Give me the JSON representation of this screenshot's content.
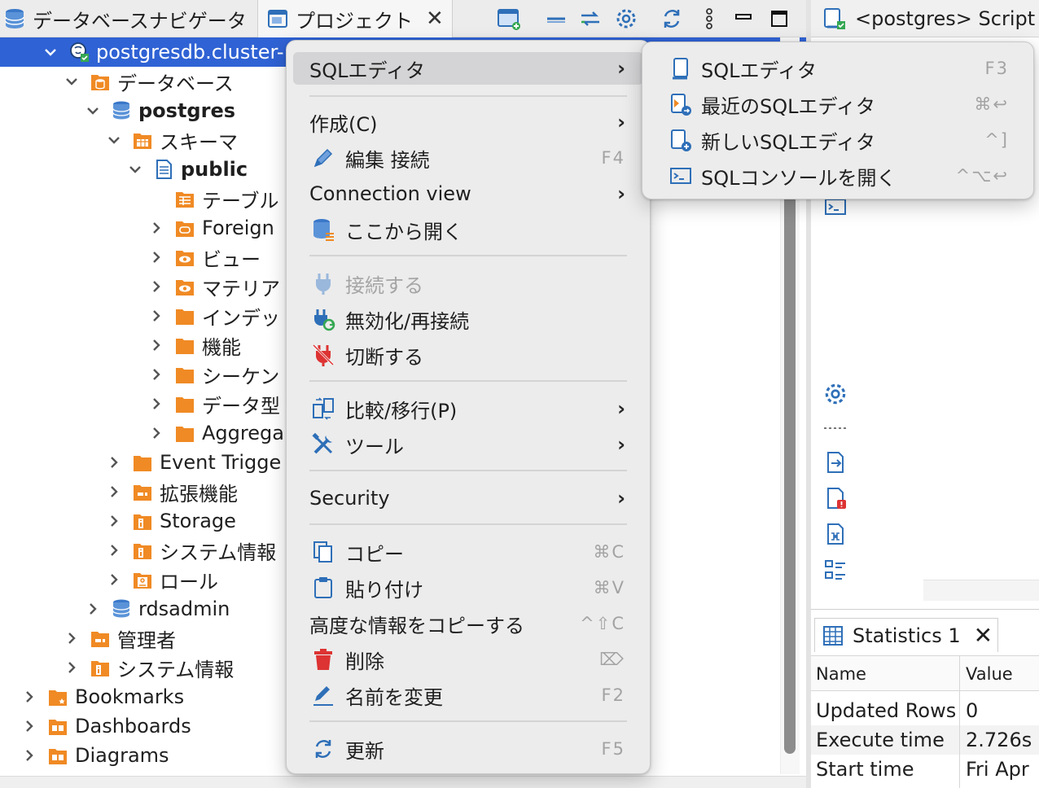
{
  "tabs": {
    "database_navigator": "データベースナビゲータ",
    "projects": "プロジェクト",
    "script": "<postgres> Script"
  },
  "tree": [
    {
      "label": "postgresdb.cluster-",
      "bold": false,
      "expanded": true,
      "icon": "postgres-connection-icon"
    },
    {
      "label": "データベース",
      "expanded": true,
      "icon": "database-folder-icon"
    },
    {
      "label": "postgres",
      "bold": true,
      "expanded": true,
      "icon": "database-icon"
    },
    {
      "label": "スキーマ",
      "expanded": true,
      "icon": "schema-folder-icon"
    },
    {
      "label": "public",
      "bold": true,
      "expanded": true,
      "icon": "schema-icon"
    },
    {
      "label": "テーブル",
      "icon": "table-folder-icon"
    },
    {
      "label": "Foreign",
      "icon": "foreign-table-folder-icon"
    },
    {
      "label": "ビュー",
      "icon": "view-folder-icon"
    },
    {
      "label": "マテリア",
      "icon": "materialized-view-folder-icon"
    },
    {
      "label": "インデッ",
      "icon": "folder-icon"
    },
    {
      "label": "機能",
      "icon": "folder-icon"
    },
    {
      "label": "シーケン",
      "icon": "folder-icon"
    },
    {
      "label": "データ型",
      "icon": "folder-icon"
    },
    {
      "label": "Aggrega",
      "icon": "folder-icon"
    },
    {
      "label": "Event Trigge",
      "icon": "folder-icon"
    },
    {
      "label": "拡張機能",
      "icon": "extension-folder-icon"
    },
    {
      "label": "Storage",
      "icon": "info-folder-icon"
    },
    {
      "label": "システム情報",
      "icon": "info-folder-icon"
    },
    {
      "label": "ロール",
      "icon": "role-folder-icon"
    },
    {
      "label": "rdsadmin",
      "icon": "database-icon"
    },
    {
      "label": "管理者",
      "icon": "extension-folder-icon"
    },
    {
      "label": "システム情報",
      "icon": "info-folder-icon"
    },
    {
      "label": "Bookmarks",
      "icon": "bookmarks-folder-icon"
    },
    {
      "label": "Dashboards",
      "icon": "dashboards-folder-icon"
    },
    {
      "label": "Diagrams",
      "icon": "diagrams-folder-icon"
    }
  ],
  "context_menu": {
    "sql_editor": "SQLエディタ",
    "create": "作成(C)",
    "edit_connection": "編集 接続",
    "edit_connection_shortcut": "F4",
    "connection_view": "Connection view",
    "open_here": "ここから開く",
    "connect": "接続する",
    "invalidate_reconnect": "無効化/再接続",
    "disconnect": "切断する",
    "compare_migrate": "比較/移行(P)",
    "tools": "ツール",
    "security": "Security",
    "copy": "コピー",
    "copy_shortcut": "⌘C",
    "paste": "貼り付け",
    "paste_shortcut": "⌘V",
    "advanced_copy": "高度な情報をコピーする",
    "advanced_copy_shortcut": "^⇧C",
    "delete": "削除",
    "delete_shortcut": "⌦",
    "rename": "名前を変更",
    "rename_shortcut": "F2",
    "refresh": "更新",
    "refresh_shortcut": "F5"
  },
  "submenu": {
    "sql_editor": "SQLエディタ",
    "sql_editor_shortcut": "F3",
    "recent_sql_editor": "最近のSQLエディタ",
    "recent_sql_editor_shortcut": "⌘↩",
    "new_sql_editor": "新しいSQLエディタ",
    "new_sql_editor_shortcut": "^]",
    "open_sql_console": "SQLコンソールを開く",
    "open_sql_console_shortcut": "^⌥↩"
  },
  "statistics": {
    "tab_label": "Statistics 1",
    "columns": [
      "Name",
      "Value"
    ],
    "rows": [
      {
        "name": "Updated Rows",
        "value": "0"
      },
      {
        "name": "Execute time",
        "value": "2.726s"
      },
      {
        "name": "Start time",
        "value": "Fri Apr"
      }
    ]
  },
  "colors": {
    "selection": "#2f62d4",
    "folder_orange": "#f08a24",
    "menu_bg": "#ececec",
    "icon_blue": "#2e6fb8"
  }
}
